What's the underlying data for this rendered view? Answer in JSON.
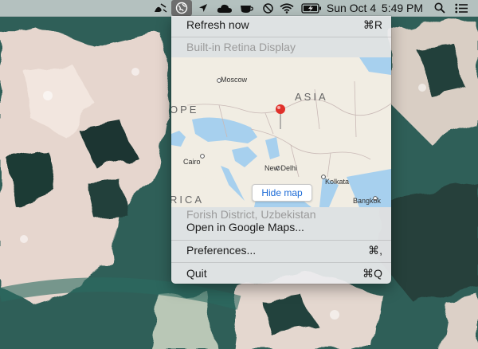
{
  "menubar": {
    "date": "Sun Oct 4",
    "time": "5:49 PM",
    "icons": [
      "brush-icon",
      "app-globe-icon",
      "location-arrow-icon",
      "cloud-icon",
      "coffee-cup-icon",
      "sync-icon",
      "wifi-icon",
      "battery-charging-icon",
      "search-icon",
      "list-icon"
    ]
  },
  "menu": {
    "refresh": {
      "label": "Refresh now",
      "shortcut": "⌘R"
    },
    "display_header": "Built-in Retina Display",
    "map": {
      "hide_map_label": "Hide map",
      "cities": [
        "Moscow",
        "Cairo",
        "New Delhi",
        "Kolkata",
        "Bangkok"
      ],
      "regions": [
        "OPE",
        "ASIA",
        "RICA"
      ],
      "pin_color": "#e0302a"
    },
    "location": "Forish District, Uzbekistan",
    "open_maps": {
      "label": "Open in Google Maps..."
    },
    "preferences": {
      "label": "Preferences...",
      "shortcut": "⌘,"
    },
    "quit": {
      "label": "Quit",
      "shortcut": "⌘Q"
    }
  }
}
